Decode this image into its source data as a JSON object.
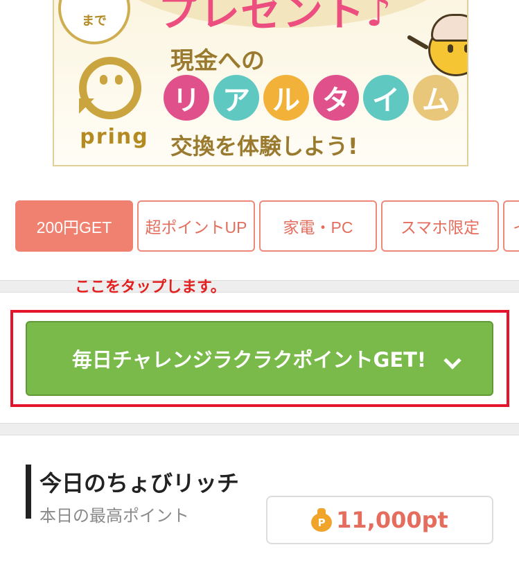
{
  "banner": {
    "top_headline": "プレゼント♪",
    "badge_text": "まで",
    "brand": "pring",
    "line1": "現金への",
    "realtime_chars": [
      "リ",
      "ア",
      "ル",
      "タ",
      "イ",
      "ム"
    ],
    "realtime_colors": [
      "#e0508a",
      "#5fc8c0",
      "#f2b23a",
      "#e0508a",
      "#5fc8c0",
      "#e8c77a"
    ],
    "line3": "交換を体験しよう!"
  },
  "tabs": [
    {
      "label": "200円GET",
      "active": true
    },
    {
      "label": "超ポイントUP",
      "active": false
    },
    {
      "label": "家電・PC",
      "active": false
    },
    {
      "label": "スマホ限定",
      "active": false
    },
    {
      "label": "イ",
      "active": false
    }
  ],
  "annotation": "ここをタップします。",
  "daily_challenge": {
    "label": "毎日チャレンジラクラクポイントGET!"
  },
  "choby_rich": {
    "title": "今日のちょびリッチ",
    "subtitle": "本日の最高ポイント",
    "coin_symbol": "P",
    "points": "11,000pt"
  },
  "colors": {
    "accent": "#f08070",
    "green_button": "#7aba4a",
    "highlight_red": "#e4142a"
  }
}
